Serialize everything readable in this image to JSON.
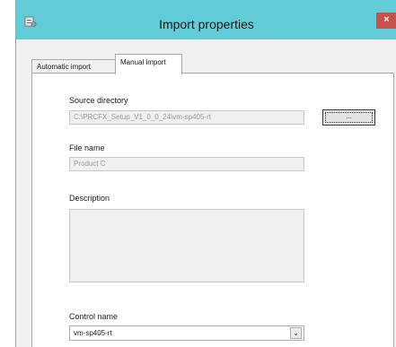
{
  "window": {
    "title": "Import properties",
    "close_glyph": "×",
    "app_icon": "properties-icon"
  },
  "tabs": [
    {
      "label": "Automatic import",
      "active": false
    },
    {
      "label": "Manual import",
      "active": true
    }
  ],
  "form": {
    "source_directory": {
      "label": "Source directory",
      "value": "C:\\PRCFX_Setup_V1_0_0_24\\vm-sp405-rt"
    },
    "browse_button": {
      "label": "..."
    },
    "file_name": {
      "label": "File name",
      "value": "Product C"
    },
    "description": {
      "label": "Description",
      "value": ""
    },
    "control_name": {
      "label": "Control name",
      "value": "vm-sp405-rt"
    }
  },
  "colors": {
    "titlebar": "#62cbd8",
    "close_button": "#c7504b"
  }
}
